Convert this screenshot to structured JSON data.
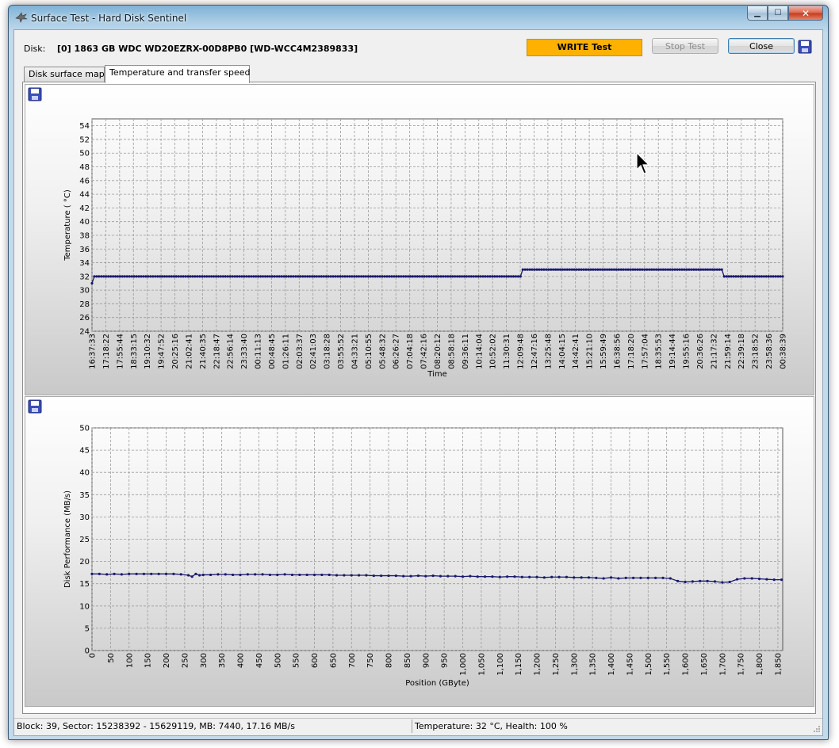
{
  "window": {
    "title": "Surface Test - Hard Disk Sentinel"
  },
  "header": {
    "disk_label": "Disk:",
    "disk_info": "[0] 1863 GB  WDC WD20EZRX-00D8PB0 [WD-WCC4M2389833]",
    "write_test_label": "WRITE Test",
    "stop_label": "Stop Test",
    "close_label": "Close"
  },
  "tabs": [
    {
      "label": "Disk surface map"
    },
    {
      "label": "Temperature and transfer speed"
    }
  ],
  "status": {
    "left": "Block: 39, Sector: 15238392 - 15629119, MB: 7440, 17.16 MB/s",
    "right": "Temperature: 32  °C, Health: 100 %"
  },
  "colors": {
    "write_test_bg": "#ffb100",
    "series_line": "#1a1a6e"
  },
  "chart_data": [
    {
      "type": "line",
      "title": "",
      "xlabel": "Time",
      "ylabel": "Temperature ( °C)",
      "ylim": [
        24,
        55
      ],
      "yticks": [
        24,
        26,
        28,
        30,
        32,
        34,
        36,
        38,
        40,
        42,
        44,
        46,
        48,
        50,
        52,
        54
      ],
      "x_tick_labels": [
        "16:37:33",
        "17:18:22",
        "17:55:44",
        "18:33:15",
        "19:10:32",
        "19:47:52",
        "20:25:16",
        "21:02:41",
        "21:40:35",
        "22:18:47",
        "22:56:14",
        "23:33:40",
        "00:11:13",
        "00:48:45",
        "01:26:11",
        "02:03:37",
        "02:41:03",
        "03:18:28",
        "03:55:52",
        "04:33:21",
        "05:10:55",
        "05:48:32",
        "06:26:27",
        "07:04:18",
        "07:42:16",
        "08:20:12",
        "08:58:18",
        "09:36:11",
        "10:14:04",
        "10:52:02",
        "11:30:31",
        "12:09:48",
        "12:47:16",
        "13:25:48",
        "14:04:15",
        "14:42:41",
        "15:21:10",
        "15:59:49",
        "16:38:56",
        "17:18:20",
        "17:57:04",
        "18:35:53",
        "19:14:44",
        "19:55:16",
        "20:36:26",
        "21:17:32",
        "21:59:14",
        "22:39:18",
        "23:18:52",
        "23:58:36",
        "00:38:39"
      ],
      "grid": true,
      "series": [
        {
          "values": [
            31,
            32,
            32,
            32,
            32,
            32,
            32,
            32,
            32,
            32,
            32,
            32,
            32,
            32,
            32,
            32,
            32,
            32,
            32,
            32,
            32,
            32,
            32,
            32,
            32,
            32,
            32,
            32,
            32,
            32,
            32,
            32,
            32,
            32,
            32,
            32,
            32,
            32,
            32,
            32,
            32,
            32,
            32,
            32,
            32,
            32,
            32,
            32,
            32,
            32,
            32,
            32,
            32,
            32,
            32,
            32,
            32,
            32,
            32,
            32,
            32,
            32,
            32,
            32,
            32,
            32,
            32,
            32,
            32,
            32,
            32,
            32,
            32,
            32,
            32,
            32,
            32,
            32,
            32,
            32,
            32,
            32,
            32,
            32,
            32,
            32,
            32,
            32,
            32,
            32,
            32,
            32,
            32,
            32,
            32,
            32,
            32,
            32,
            32,
            32,
            32,
            32,
            32,
            32,
            32,
            32,
            32,
            32,
            32,
            32,
            32,
            32,
            32,
            32,
            32,
            32,
            32,
            32,
            32,
            32,
            32,
            32,
            32,
            32,
            32,
            32,
            32,
            32,
            32,
            32,
            32,
            32,
            32,
            32,
            32,
            32,
            32,
            32,
            32,
            32,
            32,
            32,
            32,
            32,
            32,
            32,
            32,
            32,
            32,
            32,
            32,
            32,
            32,
            32,
            32,
            32,
            32,
            32,
            32,
            32,
            32,
            32,
            32,
            32,
            32,
            32,
            32,
            32,
            32,
            32,
            32,
            32,
            32,
            32,
            32,
            32,
            32,
            32,
            32,
            32,
            32,
            32,
            32,
            32,
            33,
            33,
            33,
            33,
            33,
            33,
            33,
            33,
            33,
            33,
            33,
            33,
            33,
            33,
            33,
            33,
            33,
            33,
            33,
            33,
            33,
            33,
            33,
            33,
            33,
            33,
            33,
            33,
            33,
            33,
            33,
            33,
            33,
            33,
            33,
            33,
            33,
            33,
            33,
            33,
            33,
            33,
            33,
            33,
            33,
            33,
            33,
            33,
            33,
            33,
            33,
            33,
            33,
            33,
            33,
            33,
            33,
            33,
            33,
            33,
            33,
            33,
            33,
            33,
            33,
            33,
            33,
            33,
            33,
            33,
            33,
            33,
            33,
            33,
            33,
            33,
            33,
            33,
            33,
            33,
            33,
            33,
            33,
            33,
            33,
            33,
            32,
            32,
            32,
            32,
            32,
            32,
            32,
            32,
            32,
            32,
            32,
            32,
            32,
            32,
            32,
            32,
            32,
            32,
            32,
            32,
            32,
            32,
            32,
            32,
            32,
            32
          ]
        }
      ]
    },
    {
      "type": "line",
      "title": "",
      "xlabel": "Position (GByte)",
      "ylabel": "Disk Performance (MB/s)",
      "ylim": [
        0,
        50
      ],
      "yticks": [
        0,
        5,
        10,
        15,
        20,
        25,
        30,
        35,
        40,
        45,
        50
      ],
      "xlim": [
        0,
        1863
      ],
      "xticks": [
        0,
        50,
        100,
        150,
        200,
        250,
        300,
        350,
        400,
        450,
        500,
        550,
        600,
        650,
        700,
        750,
        800,
        850,
        900,
        950,
        1000,
        1050,
        1100,
        1150,
        1200,
        1250,
        1300,
        1350,
        1400,
        1450,
        1500,
        1550,
        1600,
        1650,
        1700,
        1750,
        1800,
        1850
      ],
      "x_tick_labels": [
        "0",
        "50",
        "100",
        "150",
        "200",
        "250",
        "300",
        "350",
        "400",
        "450",
        "500",
        "550",
        "600",
        "650",
        "700",
        "750",
        "800",
        "850",
        "900",
        "950",
        "1,000",
        "1,050",
        "1,100",
        "1,150",
        "1,200",
        "1,250",
        "1,300",
        "1,350",
        "1,400",
        "1,450",
        "1,500",
        "1,550",
        "1,600",
        "1,650",
        "1,700",
        "1,750",
        "1,800",
        "1,850"
      ],
      "grid": true,
      "series": [
        {
          "x": [
            0,
            20,
            40,
            60,
            80,
            100,
            120,
            140,
            160,
            180,
            200,
            220,
            240,
            260,
            270,
            280,
            290,
            300,
            320,
            340,
            360,
            380,
            400,
            420,
            440,
            460,
            480,
            500,
            520,
            540,
            560,
            580,
            600,
            620,
            640,
            660,
            680,
            700,
            720,
            740,
            760,
            780,
            800,
            820,
            840,
            860,
            880,
            900,
            920,
            940,
            960,
            980,
            1000,
            1020,
            1040,
            1060,
            1080,
            1100,
            1120,
            1140,
            1160,
            1180,
            1200,
            1220,
            1240,
            1260,
            1280,
            1300,
            1320,
            1340,
            1360,
            1380,
            1400,
            1420,
            1440,
            1460,
            1480,
            1500,
            1520,
            1540,
            1560,
            1580,
            1600,
            1620,
            1640,
            1660,
            1680,
            1700,
            1720,
            1740,
            1760,
            1780,
            1800,
            1820,
            1840,
            1860
          ],
          "y": [
            17.2,
            17.2,
            17.1,
            17.2,
            17.1,
            17.2,
            17.2,
            17.2,
            17.2,
            17.2,
            17.2,
            17.2,
            17.1,
            16.9,
            16.6,
            17.2,
            16.9,
            17.0,
            17.0,
            17.1,
            17.1,
            17.0,
            17.0,
            17.1,
            17.1,
            17.1,
            17.0,
            17.0,
            17.1,
            17.0,
            17.0,
            17.0,
            17.0,
            17.0,
            17.0,
            16.9,
            16.9,
            16.9,
            16.9,
            16.9,
            16.8,
            16.8,
            16.8,
            16.8,
            16.7,
            16.7,
            16.8,
            16.7,
            16.8,
            16.7,
            16.7,
            16.7,
            16.6,
            16.7,
            16.6,
            16.6,
            16.6,
            16.5,
            16.6,
            16.6,
            16.5,
            16.5,
            16.5,
            16.4,
            16.5,
            16.5,
            16.5,
            16.4,
            16.4,
            16.4,
            16.3,
            16.2,
            16.4,
            16.2,
            16.3,
            16.3,
            16.3,
            16.3,
            16.3,
            16.3,
            16.2,
            15.6,
            15.4,
            15.5,
            15.6,
            15.6,
            15.5,
            15.3,
            15.4,
            16.0,
            16.2,
            16.2,
            16.1,
            16.0,
            15.9,
            15.9
          ]
        }
      ]
    }
  ]
}
